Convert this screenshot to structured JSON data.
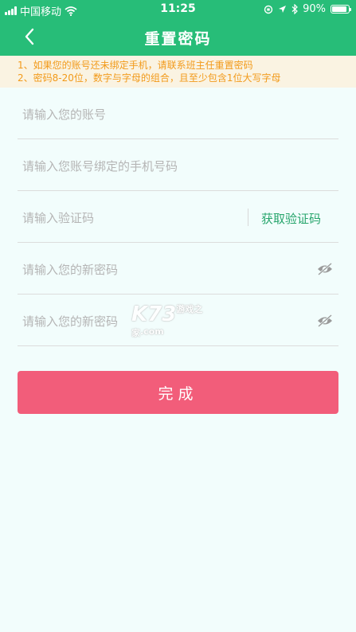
{
  "status_bar": {
    "carrier": "中国移动",
    "time": "11:25",
    "battery": "90%",
    "battery_level": 0.9
  },
  "header": {
    "title": "重置密码",
    "back_icon": "chevron-left-icon"
  },
  "notice": {
    "line1": "1、如果您的账号还未绑定手机，请联系班主任重置密码",
    "line2": "2、密码8-20位，数字与字母的组合，且至少包含1位大写字母"
  },
  "form": {
    "account_placeholder": "请输入您的账号",
    "phone_placeholder": "请输入您账号绑定的手机号码",
    "code_placeholder": "请输入验证码",
    "get_code_label": "获取验证码",
    "new_password_placeholder": "请输入您的新密码",
    "confirm_password_placeholder": "请输入您的新密码"
  },
  "submit_label": "完成",
  "watermark": {
    "main": "K73",
    "sub": "游戏之家",
    "domain": ".com"
  },
  "colors": {
    "header": "#27bd78",
    "notice_bg": "#faf3e2",
    "notice_text": "#f29a1a",
    "accent_green": "#27a56c",
    "submit": "#f25d7a",
    "background": "#f2fdfc"
  }
}
